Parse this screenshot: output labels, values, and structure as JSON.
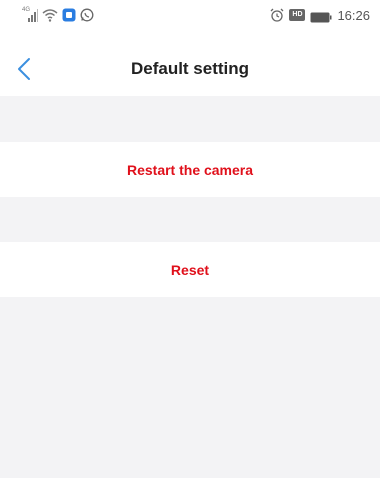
{
  "status_bar": {
    "network_label": "4G",
    "time": "16:26",
    "hd_badge": "HD",
    "icons": [
      "signal-icon",
      "wifi-icon",
      "app-notification-icon",
      "whatsapp-icon",
      "alarm-icon",
      "hd-icon",
      "battery-icon"
    ]
  },
  "header": {
    "title": "Default setting",
    "back_icon": "chevron-left-icon"
  },
  "actions": {
    "restart_label": "Restart the camera",
    "reset_label": "Reset"
  },
  "colors": {
    "accent_back": "#3b8fe0",
    "action_text": "#e0101b",
    "section_gap": "#f3f3f5"
  }
}
